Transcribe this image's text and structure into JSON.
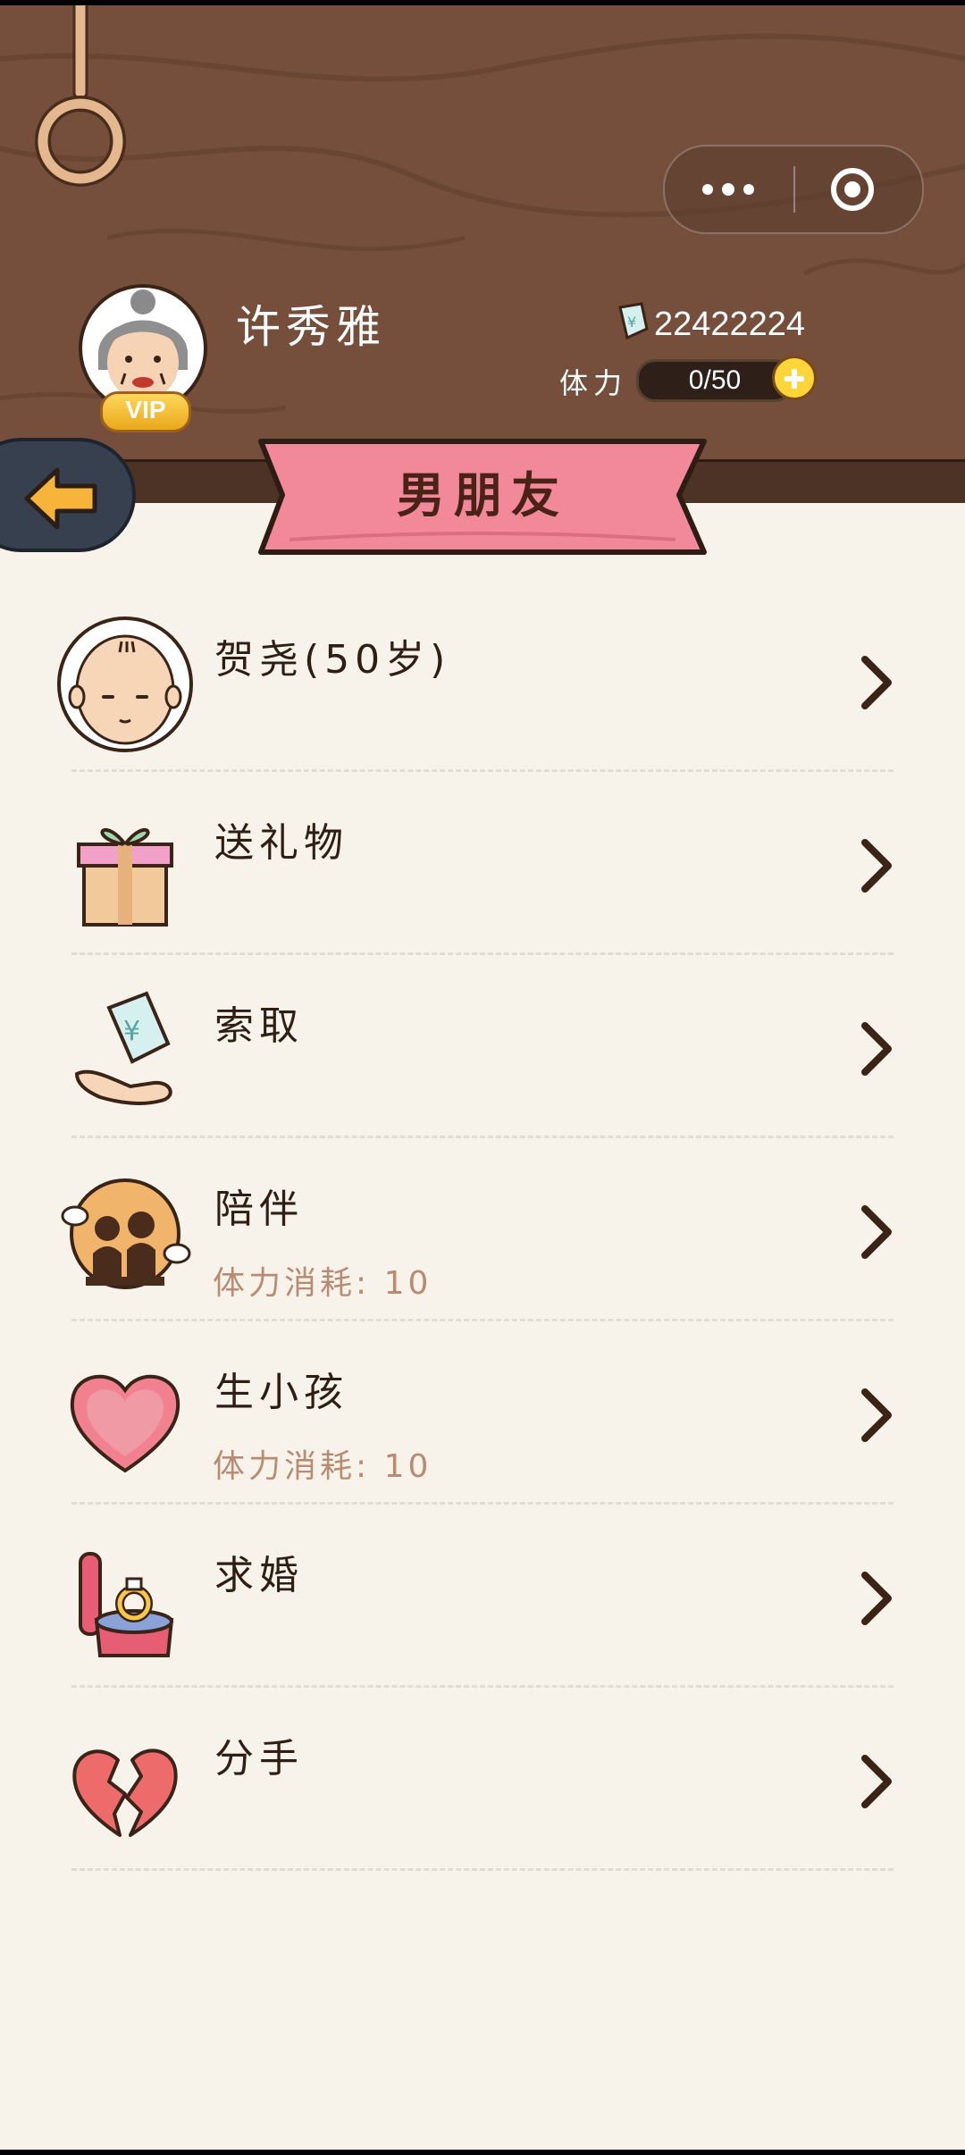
{
  "player": {
    "name": "许秀雅",
    "vip_label": "VIP",
    "coins": "22422224",
    "stamina_label": "体力",
    "stamina_value": "0/50"
  },
  "page": {
    "title": "男朋友"
  },
  "capsule": {
    "more_icon": "more-dots-icon",
    "close_icon": "target-close-icon"
  },
  "items": [
    {
      "id": "boyfriend",
      "label": "贺尧(50岁)",
      "sub": "",
      "icon": "bald-man-avatar-icon"
    },
    {
      "id": "gift",
      "label": "送礼物",
      "sub": "",
      "icon": "gift-box-icon"
    },
    {
      "id": "ask",
      "label": "索取",
      "sub": "",
      "icon": "hand-money-icon"
    },
    {
      "id": "company",
      "label": "陪伴",
      "sub": "体力消耗: 10",
      "icon": "couple-silhouette-icon"
    },
    {
      "id": "baby",
      "label": "生小孩",
      "sub": "体力消耗: 10",
      "icon": "heart-icon"
    },
    {
      "id": "propose",
      "label": "求婚",
      "sub": "",
      "icon": "ring-box-icon"
    },
    {
      "id": "breakup",
      "label": "分手",
      "sub": "",
      "icon": "broken-heart-icon"
    }
  ]
}
